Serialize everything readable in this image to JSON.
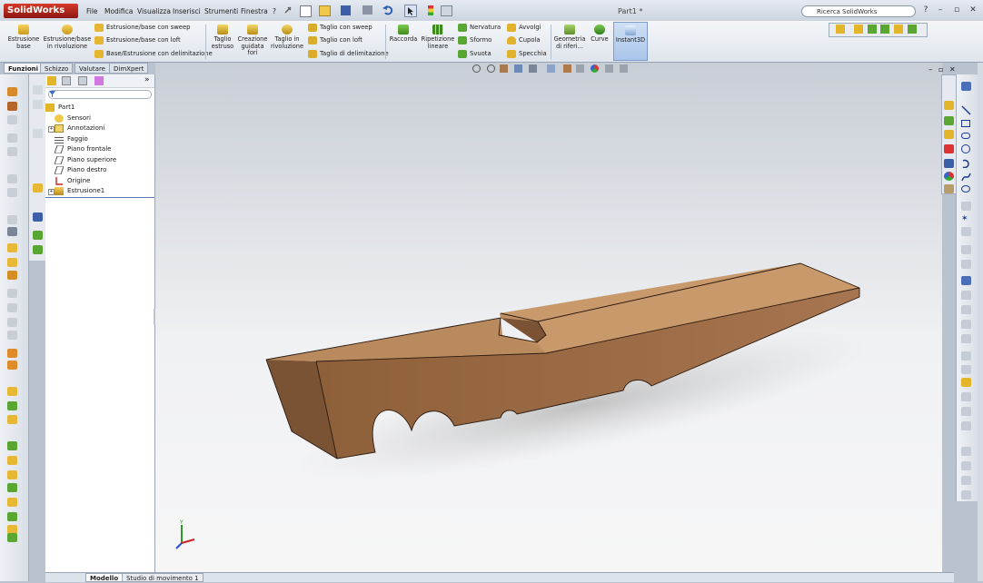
{
  "app": {
    "logo": "SolidWorks",
    "document_title": "Part1 *"
  },
  "menu": [
    "File",
    "Modifica",
    "Visualizza",
    "Inserisci",
    "Strumenti",
    "Finestra",
    "?"
  ],
  "search": {
    "label": "Ricerca SolidWorks"
  },
  "window_controls": [
    "?",
    "–",
    "▫",
    "✕"
  ],
  "commands": {
    "estrusione_base": "Estrusione\nbase",
    "estrusione_rivoluzione": "Estrusione/base\nin rivoluzione",
    "sweep": "Estrusione/base con sweep",
    "loft": "Estrusione/base con loft",
    "delimitazione": "Base/Estrusione con delimitazione",
    "taglio_estruso": "Taglio\nestruso",
    "creazione_fori": "Creazione\nguidata\nfori",
    "taglio_rivoluzione": "Taglio in\nrivoluzione",
    "taglio_sweep": "Taglio con sweep",
    "taglio_loft": "Taglio con loft",
    "taglio_delimitazione": "Taglio di delimitazione",
    "raccorda": "Raccorda",
    "ripetizione": "Ripetizione\nlineare",
    "nervatura": "Nervatura",
    "sformo": "Sformo",
    "svuota": "Svuota",
    "avvolgi": "Avvolgi",
    "cupola": "Cupola",
    "specchia": "Specchia",
    "geometria": "Geometria\ndi riferi...",
    "curve": "Curve",
    "instant3d": "Instant3D"
  },
  "tabs": [
    "Funzioni",
    "Schizzo",
    "Valutare",
    "DimXpert"
  ],
  "tree": {
    "root": "Part1",
    "items": [
      {
        "label": "Sensori",
        "expandable": false
      },
      {
        "label": "Annotazioni",
        "expandable": true
      },
      {
        "label": "Faggio",
        "expandable": false
      },
      {
        "label": "Piano frontale",
        "expandable": false
      },
      {
        "label": "Piano superiore",
        "expandable": false
      },
      {
        "label": "Piano destro",
        "expandable": false
      },
      {
        "label": "Origine",
        "expandable": false
      },
      {
        "label": "Estrusione1",
        "expandable": true
      }
    ]
  },
  "bottom_tabs": [
    "Modello",
    "Studio di movimento 1"
  ],
  "colors": {
    "wood_top": "#c99a6a",
    "wood_front": "#9c6b44",
    "wood_side": "#7a5234",
    "accent": "#d63a2a"
  }
}
